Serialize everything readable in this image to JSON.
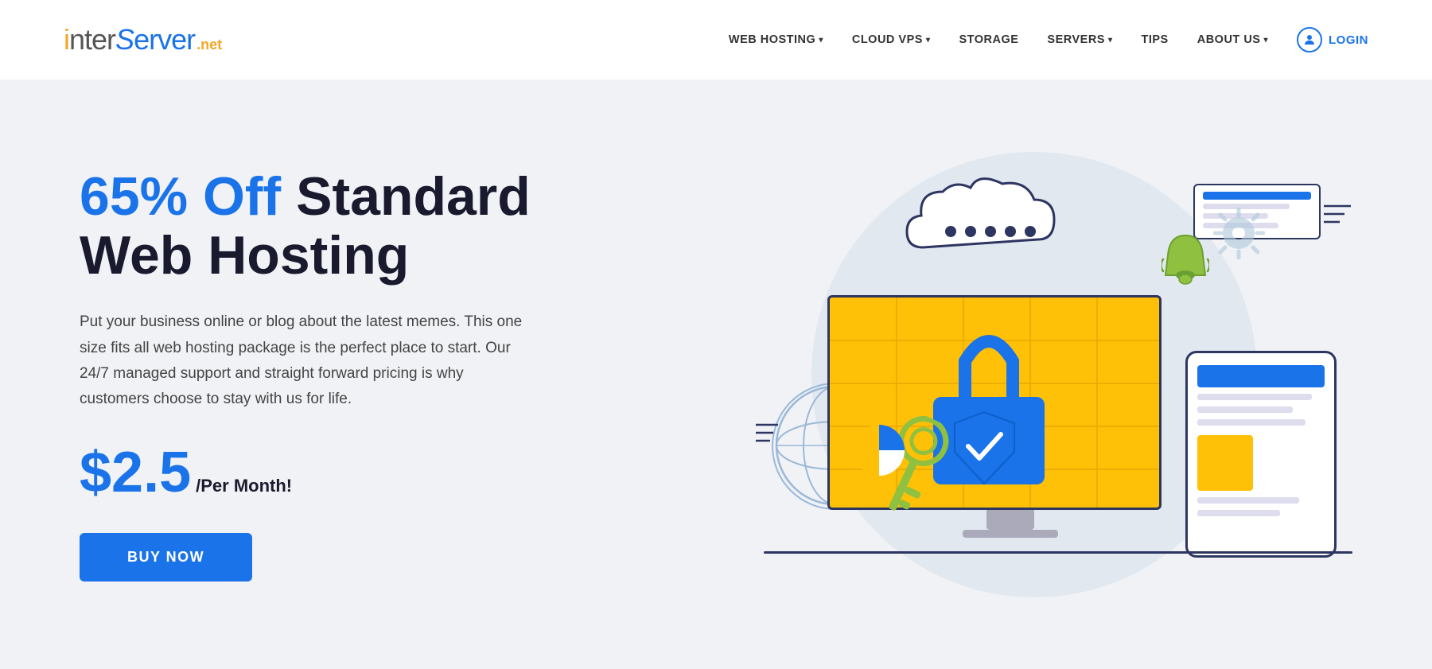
{
  "logo": {
    "prefix": "inter",
    "s_curve": "S",
    "suffix": "erver",
    "tld": ".net"
  },
  "nav": {
    "items": [
      {
        "label": "WEB HOSTING",
        "has_dropdown": true
      },
      {
        "label": "CLOUD VPS",
        "has_dropdown": true
      },
      {
        "label": "STORAGE",
        "has_dropdown": false
      },
      {
        "label": "SERVERS",
        "has_dropdown": true
      },
      {
        "label": "TIPS",
        "has_dropdown": false
      },
      {
        "label": "ABOUT US",
        "has_dropdown": true
      }
    ],
    "login_label": "LOGIN"
  },
  "hero": {
    "title_highlight": "65% Off",
    "title_dark": " Standard\nWeb Hosting",
    "description": "Put your business online or blog about the latest memes. This one size fits all web hosting package is the perfect place to start. Our 24/7 managed support and straight forward pricing is why customers choose to stay with us for life.",
    "price_amount": "$2.5",
    "price_period": "/Per Month!",
    "cta_button": "BUY NOW"
  },
  "colors": {
    "blue": "#1a73e8",
    "dark": "#1a1a2e",
    "accent": "#ffc107",
    "green": "#90c040",
    "light_bg": "#f0f2f5"
  }
}
